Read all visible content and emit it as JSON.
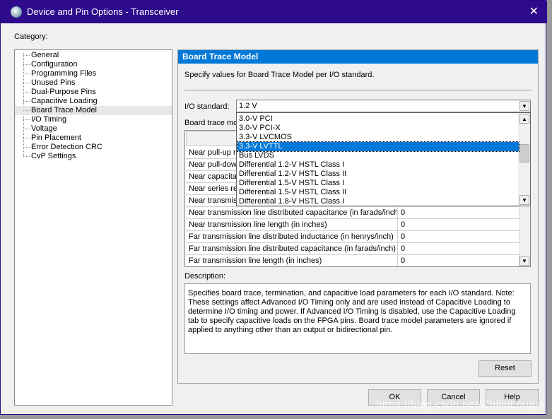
{
  "window": {
    "title": "Device and Pin Options - Transceiver",
    "close": "✕"
  },
  "category_label": "Category:",
  "tree": [
    "General",
    "Configuration",
    "Programming Files",
    "Unused Pins",
    "Dual-Purpose Pins",
    "Capacitive Loading",
    "Board Trace Model",
    "I/O Timing",
    "Voltage",
    "Pin Placement",
    "Error Detection CRC",
    "CvP Settings"
  ],
  "tree_selected": "Board Trace Model",
  "panel": {
    "header": "Board Trace Model",
    "intro": "Specify values for Board Trace Model per I/O standard.",
    "io_label": "I/O standard:",
    "io_value": "1.2 V",
    "model_label": "Board trace mo"
  },
  "dropdown": {
    "items": [
      "3.0-V PCI",
      "3.0-V PCI-X",
      "3.3-V LVCMOS",
      "3.3-V LVTTL",
      "Bus LVDS",
      "Differential 1.2-V HSTL Class I",
      "Differential 1.2-V HSTL Class II",
      "Differential 1.5-V HSTL Class I",
      "Differential 1.5-V HSTL Class II",
      "Differential 1.8-V HSTL Class I"
    ],
    "selected": "3.3-V LVTTL"
  },
  "table": {
    "rows": [
      {
        "name": "Near pull-up re",
        "value": ""
      },
      {
        "name": "Near pull-dow",
        "value": ""
      },
      {
        "name": "Near capacitar",
        "value": ""
      },
      {
        "name": "Near series re",
        "value": ""
      },
      {
        "name": "Near transmis",
        "value": ""
      },
      {
        "name": "Near transmission line distributed capacitance (in farads/inch)",
        "value": "0"
      },
      {
        "name": "Near transmission line length (in inches)",
        "value": "0"
      },
      {
        "name": "Far transmission line distributed inductance (in henrys/inch)",
        "value": "0"
      },
      {
        "name": "Far transmission line distributed capacitance (in farads/inch)",
        "value": "0"
      },
      {
        "name": "Far transmission line length (in inches)",
        "value": "0"
      }
    ]
  },
  "description": {
    "label": "Description:",
    "text": "Specifies board trace, termination, and capacitive load parameters for each I/O standard.  Note: These settings affect Advanced I/O Timing only and are used instead of Capacitive Loading to determine I/O timing and power. If Advanced I/O Timing is disabled, use the Capacitive Loading tab to specify capacitive loads on the FPGA pins. Board trace model parameters are ignored if applied to anything other than an output or bidirectional pin."
  },
  "buttons": {
    "reset": "Reset",
    "ok": "OK",
    "cancel": "Cancel",
    "help": "Help"
  },
  "watermark": "https://blog.csdn.net/ChijinLoujue",
  "colors": {
    "titlebar": "#2e0b8c",
    "accent": "#0078d7"
  }
}
